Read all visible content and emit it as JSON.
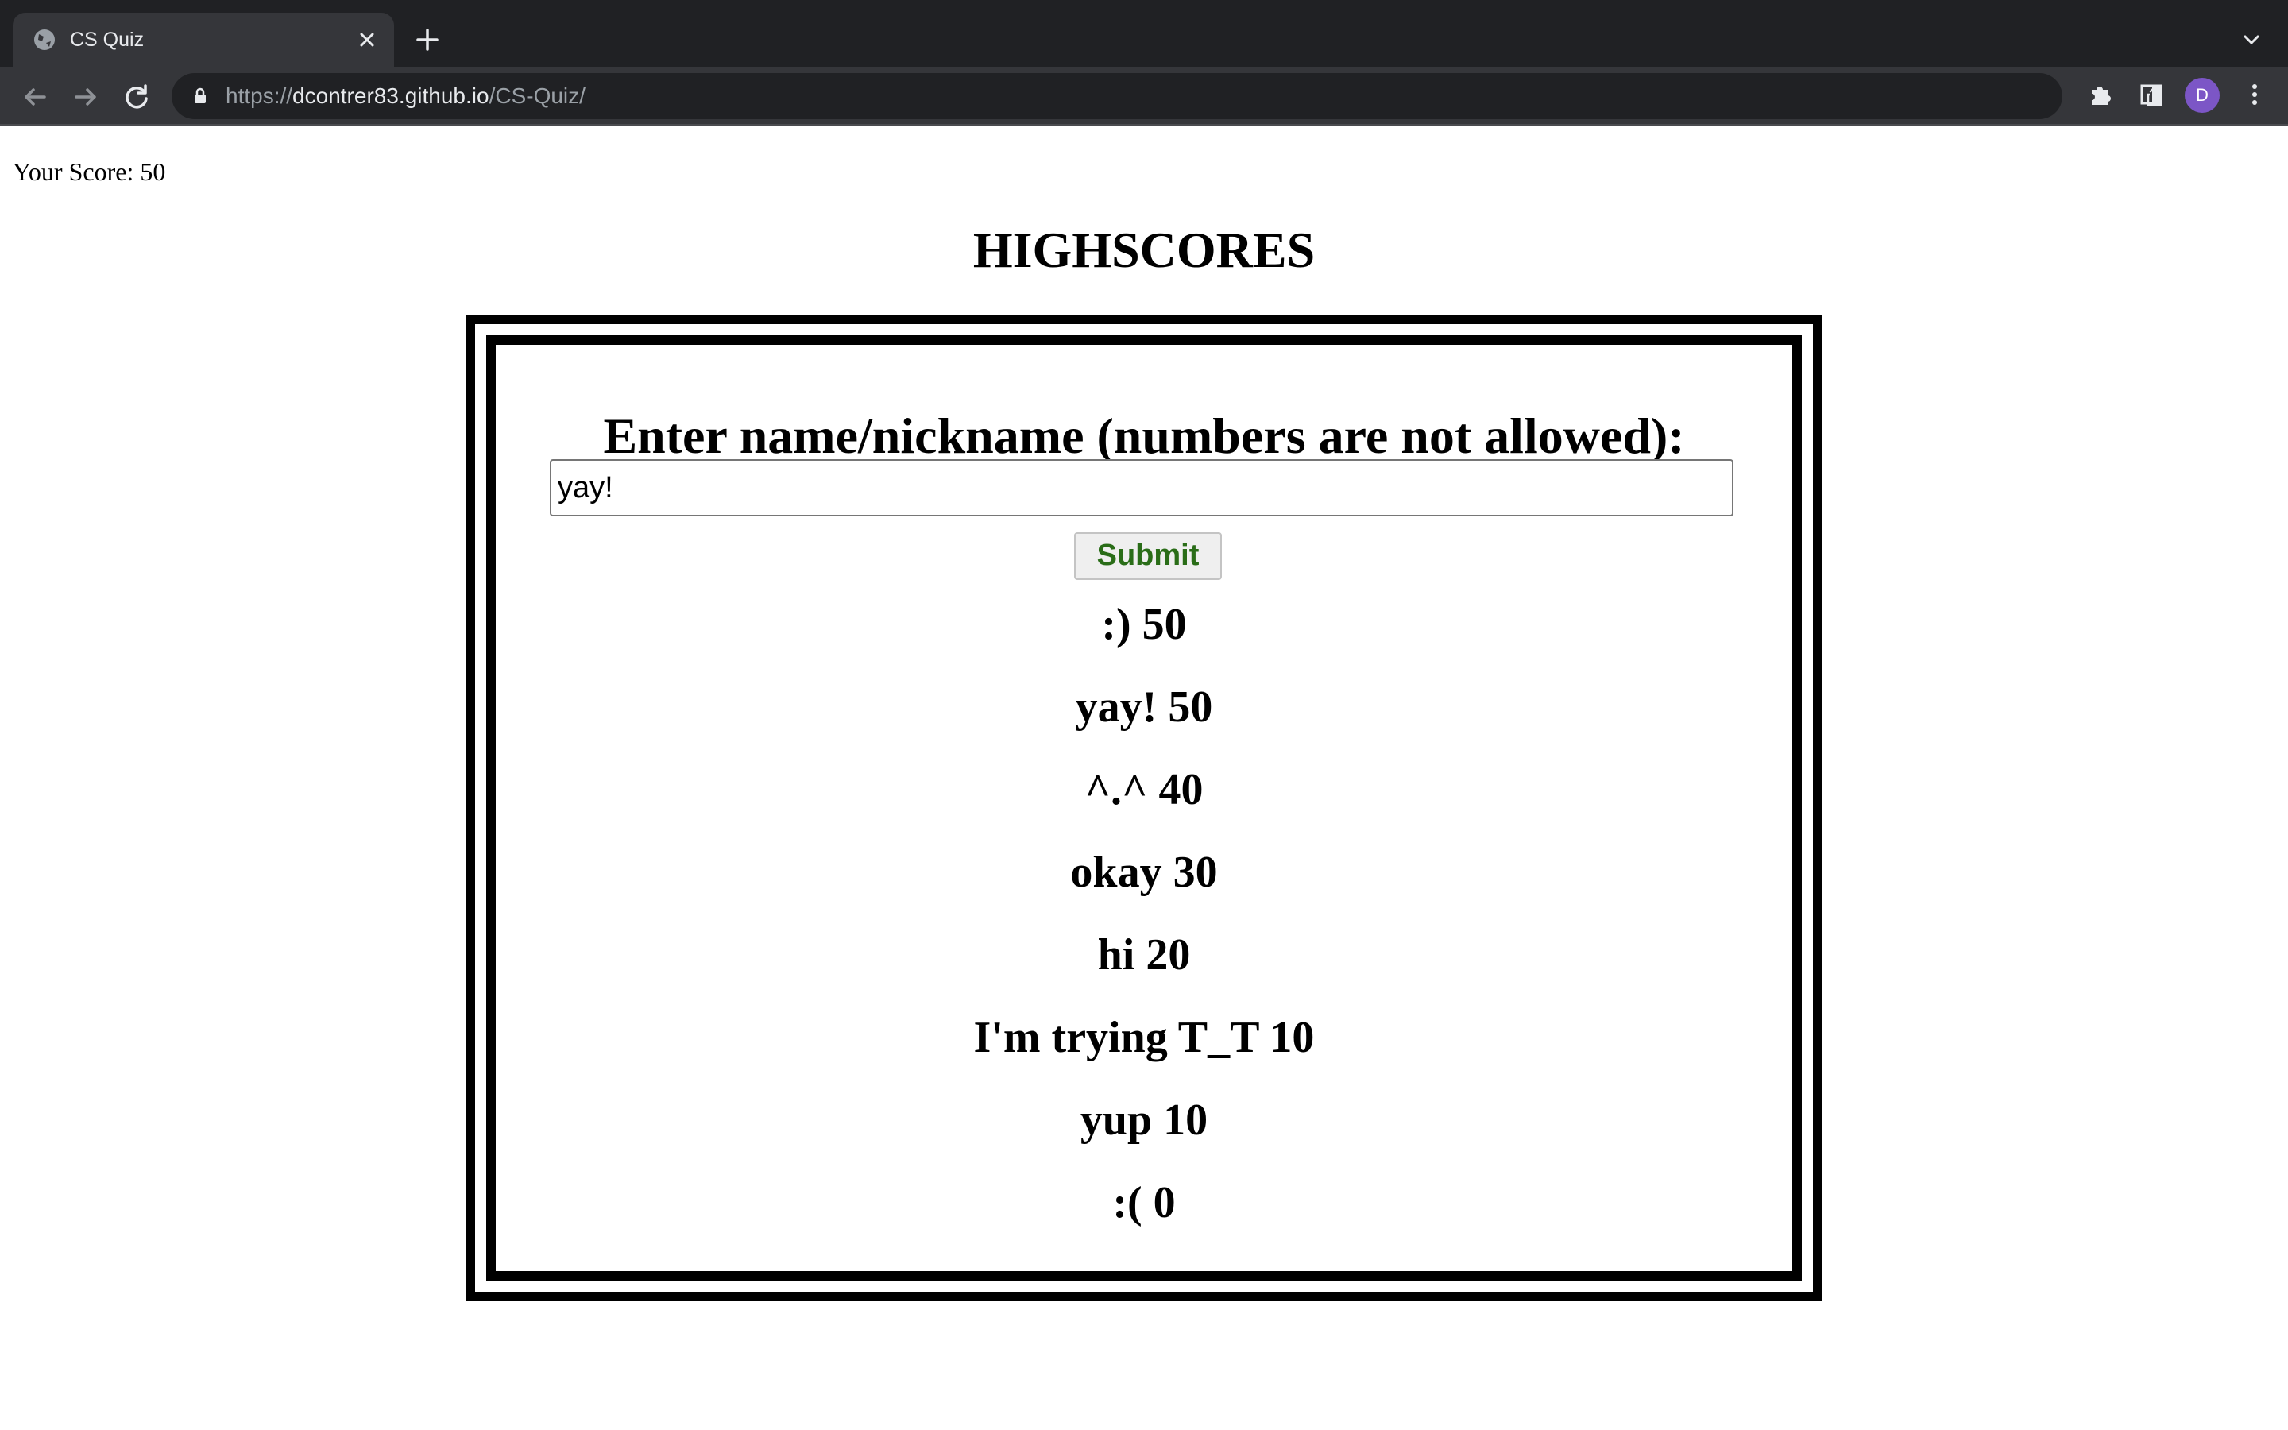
{
  "browser": {
    "tab": {
      "title": "CS Quiz",
      "icon": "globe-icon"
    },
    "url": {
      "scheme": "https://",
      "host": "dcontrer83.github.io",
      "path": "/CS-Quiz/"
    },
    "avatar_initial": "D",
    "colors": {
      "tabstrip": "#202124",
      "toolbar": "#35363a",
      "avatar": "#7c56c6"
    }
  },
  "page": {
    "score_label": "Your Score: 50",
    "title": "HIGHSCORES",
    "form": {
      "prompt": "Enter name/nickname (numbers are not allowed):",
      "name_value": "yay!",
      "submit_label": "Submit"
    },
    "highscores": [
      ":) 50",
      "yay! 50",
      "^.^ 40",
      "okay 30",
      "hi 20",
      "I'm trying T_T 10",
      "yup 10",
      ":( 0"
    ],
    "colors": {
      "submit_text": "#2a6d18",
      "frame": "#000000"
    }
  }
}
